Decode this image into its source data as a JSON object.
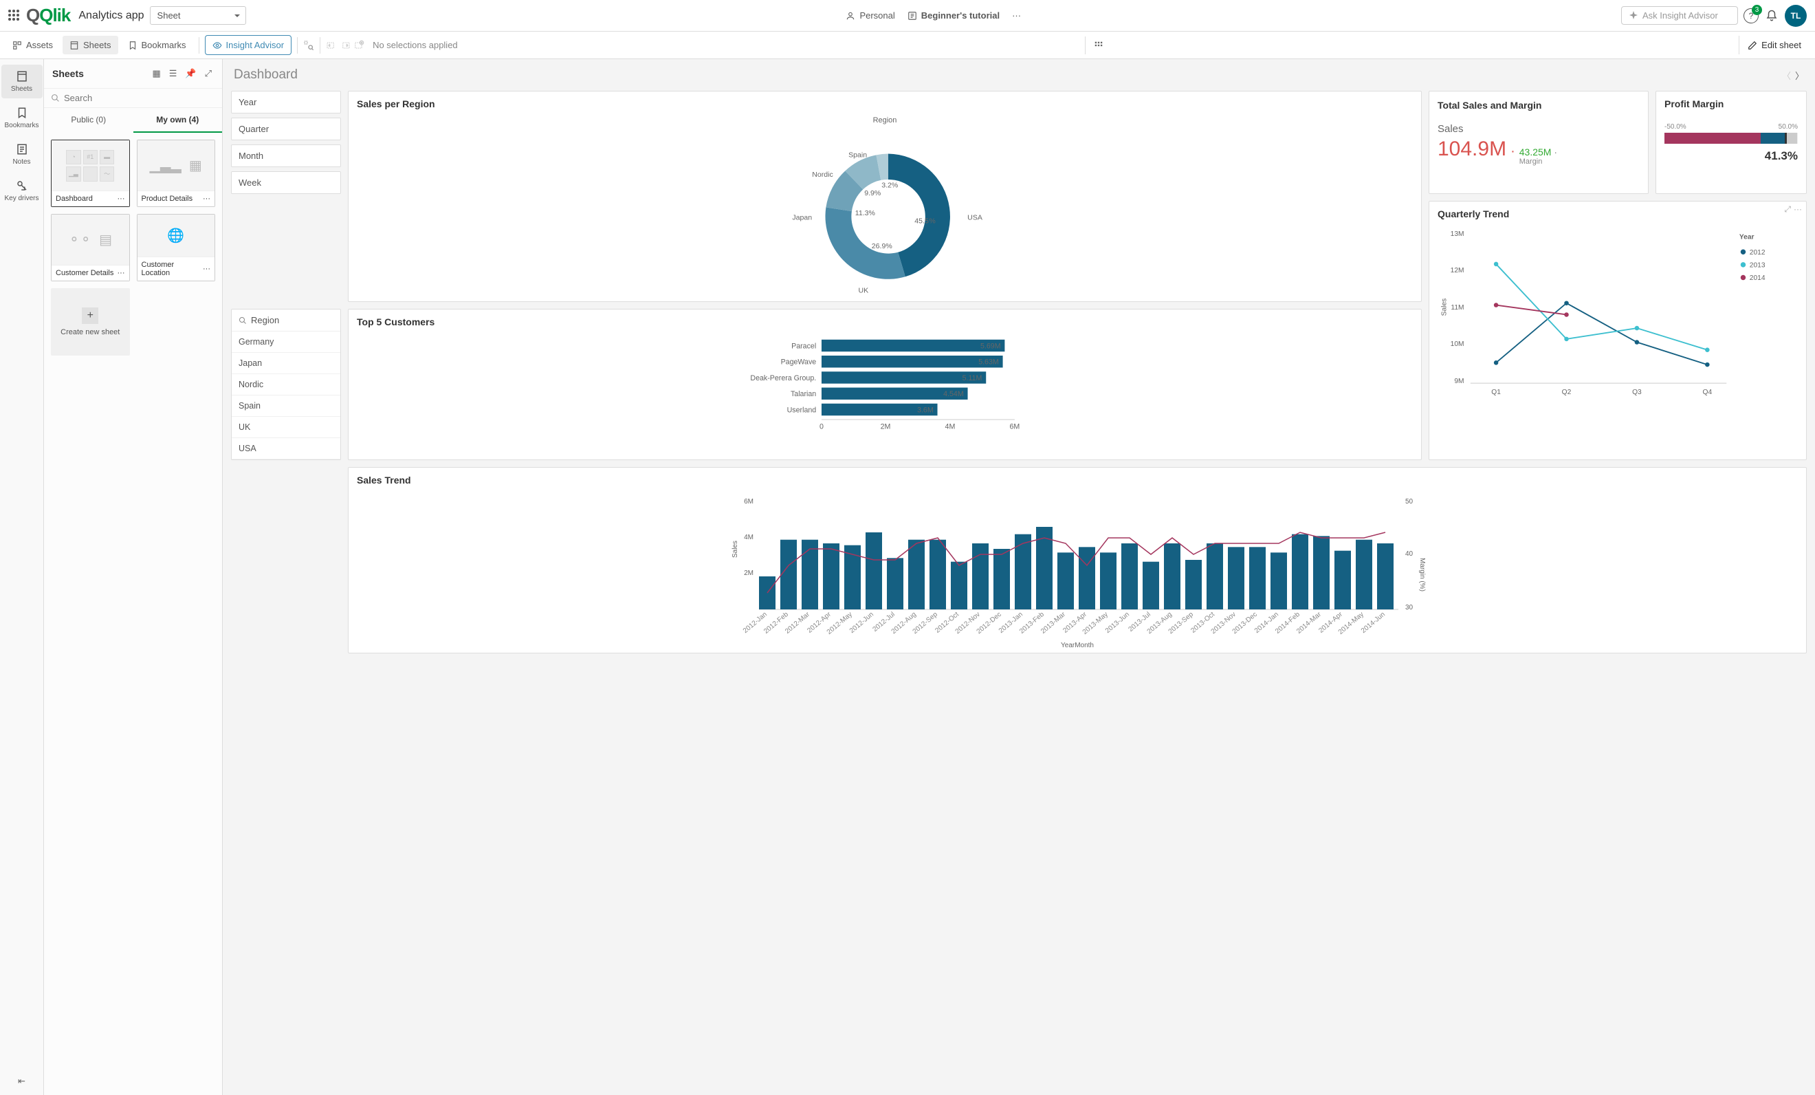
{
  "topbar": {
    "logo_green": "Qlik",
    "app_name": "Analytics app",
    "sheet_dd": "Sheet",
    "personal": "Personal",
    "tutorial": "Beginner's tutorial",
    "ask_placeholder": "Ask Insight Advisor",
    "help_count": "3",
    "avatar": "TL"
  },
  "toolbar": {
    "assets": "Assets",
    "sheets": "Sheets",
    "bookmarks": "Bookmarks",
    "insight": "Insight Advisor",
    "nosel": "No selections applied",
    "edit": "Edit sheet"
  },
  "leftrail": {
    "sheets": "Sheets",
    "bookmarks": "Bookmarks",
    "notes": "Notes",
    "key": "Key drivers"
  },
  "sheets_panel": {
    "title": "Sheets",
    "search_placeholder": "Search",
    "tab_public": "Public (0)",
    "tab_myown": "My own (4)",
    "thumbs": [
      "Dashboard",
      "Product Details",
      "Customer Details",
      "Customer Location"
    ],
    "new": "Create new sheet"
  },
  "dashboard": {
    "title": "Dashboard",
    "time_pills": [
      "Year",
      "Quarter",
      "Month",
      "Week"
    ],
    "region_filter": {
      "title": "Region",
      "items": [
        "Germany",
        "Japan",
        "Nordic",
        "Spain",
        "UK",
        "USA"
      ]
    },
    "sales_region": {
      "title": "Sales per Region",
      "legend": "Region"
    },
    "top5": {
      "title": "Top 5 Customers"
    },
    "kpi": {
      "title": "Total Sales and Margin",
      "label": "Sales",
      "value": "104.9M",
      "sub": "43.25M",
      "sublabel": "Margin"
    },
    "profit": {
      "title": "Profit Margin",
      "min": "-50.0%",
      "max": "50.0%",
      "value": "41.3%"
    },
    "qt": {
      "title": "Quarterly Trend",
      "legend_title": "Year",
      "y": [
        "13M",
        "12M",
        "11M",
        "10M",
        "9M"
      ],
      "x": [
        "Q1",
        "Q2",
        "Q3",
        "Q4"
      ],
      "series": [
        "2012",
        "2013",
        "2014"
      ],
      "ylabel": "Sales"
    },
    "st": {
      "title": "Sales Trend",
      "xlabel": "YearMonth",
      "ylabel": "Sales",
      "y2label": "Margin (%)"
    }
  },
  "chart_data": {
    "sales_per_region": {
      "type": "pie",
      "title": "Sales per Region",
      "series": [
        {
          "name": "USA",
          "value": 45.5
        },
        {
          "name": "UK",
          "value": 26.9
        },
        {
          "name": "Japan",
          "value": 11.3
        },
        {
          "name": "Nordic",
          "value": 9.9
        },
        {
          "name": "Spain",
          "value": 3.2
        }
      ],
      "colors": [
        "#156082",
        "#4a8aa8",
        "#6fa2b8",
        "#8fb8c8",
        "#b0cdd8"
      ]
    },
    "top5_customers": {
      "type": "bar",
      "orientation": "horizontal",
      "categories": [
        "Paracel",
        "PageWave",
        "Deak-Perera Group.",
        "Talarian",
        "Userland"
      ],
      "values": [
        5.69,
        5.63,
        5.11,
        4.54,
        3.6
      ],
      "value_labels": [
        "5.69M",
        "5.63M",
        "5.11M",
        "4.54M",
        "3.6M"
      ],
      "xlim": [
        0,
        6
      ],
      "xticks": [
        "0",
        "2M",
        "4M",
        "6M"
      ]
    },
    "profit_margin": {
      "type": "bullet",
      "value": 41.3,
      "min": -50,
      "max": 50
    },
    "quarterly_trend": {
      "type": "line",
      "categories": [
        "Q1",
        "Q2",
        "Q3",
        "Q4"
      ],
      "series": [
        {
          "name": "2012",
          "values": [
            9.5,
            11.1,
            10.05,
            9.45
          ]
        },
        {
          "name": "2013",
          "values": [
            12.15,
            10.15,
            10.45,
            9.85
          ]
        },
        {
          "name": "2014",
          "values": [
            11.05,
            10.8,
            null,
            null
          ]
        }
      ],
      "ylim": [
        9,
        13
      ],
      "ylabel": "Sales"
    },
    "sales_trend": {
      "type": "bar",
      "categories": [
        "2012-Jan",
        "2012-Feb",
        "2012-Mar",
        "2012-Apr",
        "2012-May",
        "2012-Jun",
        "2012-Jul",
        "2012-Aug",
        "2012-Sep",
        "2012-Oct",
        "2012-Nov",
        "2012-Dec",
        "2013-Jan",
        "2013-Feb",
        "2013-Mar",
        "2013-Apr",
        "2013-May",
        "2013-Jun",
        "2013-Jul",
        "2013-Aug",
        "2013-Sep",
        "2013-Oct",
        "2013-Nov",
        "2013-Dec",
        "2014-Jan",
        "2014-Feb",
        "2014-Mar",
        "2014-Apr",
        "2014-May",
        "2014-Jun"
      ],
      "values": [
        1.8,
        3.8,
        3.8,
        3.6,
        3.5,
        4.2,
        2.8,
        3.8,
        3.8,
        2.6,
        3.6,
        3.3,
        4.1,
        4.5,
        3.1,
        3.4,
        3.1,
        3.6,
        2.6,
        3.6,
        2.7,
        3.6,
        3.4,
        3.4,
        3.1,
        4.1,
        4.0,
        3.2,
        3.8,
        3.6
      ],
      "margin_line": [
        33,
        38,
        41,
        41,
        40,
        39,
        39,
        42,
        43,
        38,
        40,
        40,
        42,
        43,
        42,
        38,
        43,
        43,
        40,
        43,
        40,
        42,
        42,
        42,
        42,
        44,
        43,
        43,
        43,
        44
      ],
      "ylim": [
        0,
        6
      ],
      "yticks": [
        "2M",
        "4M",
        "6M"
      ],
      "y2lim": [
        30,
        50
      ],
      "y2ticks": [
        "30",
        "40",
        "50"
      ]
    }
  }
}
